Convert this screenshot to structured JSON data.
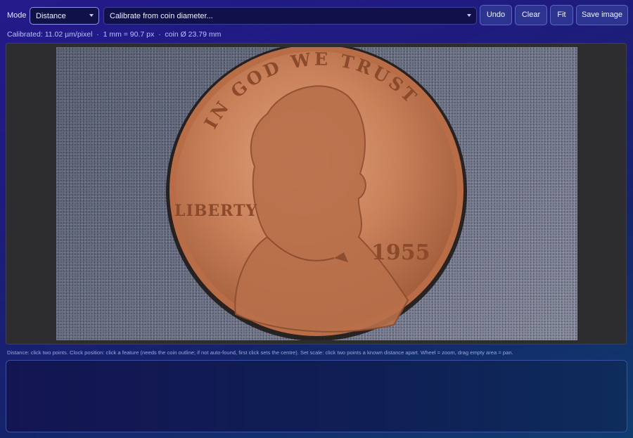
{
  "toolbar": {
    "mode_label": "Mode",
    "mode_value": "Distance",
    "calibration_value": "Calibrate from coin diameter...",
    "undo_label": "Undo",
    "clear_label": "Clear",
    "fit_label": "Fit",
    "save_label": "Save image"
  },
  "status": {
    "text": "Calibrated: 11.02 µm/pixel  ·  1 mm = 90.7 px  ·  coin Ø 23.79 mm"
  },
  "coin": {
    "motto": "IN GOD WE TRUST",
    "liberty": "LIBERTY",
    "year": "1955",
    "colors": {
      "copper": "#c9815a",
      "rim": "#b96d47",
      "shadow": "#2a1a14"
    }
  },
  "help": {
    "text": "Distance: click two points. Clock position: click a feature (needs the coin outline; if not auto-found, first click sets the centre). Set scale: click two points a known distance apart. Wheel = zoom, drag empty area = pan."
  }
}
